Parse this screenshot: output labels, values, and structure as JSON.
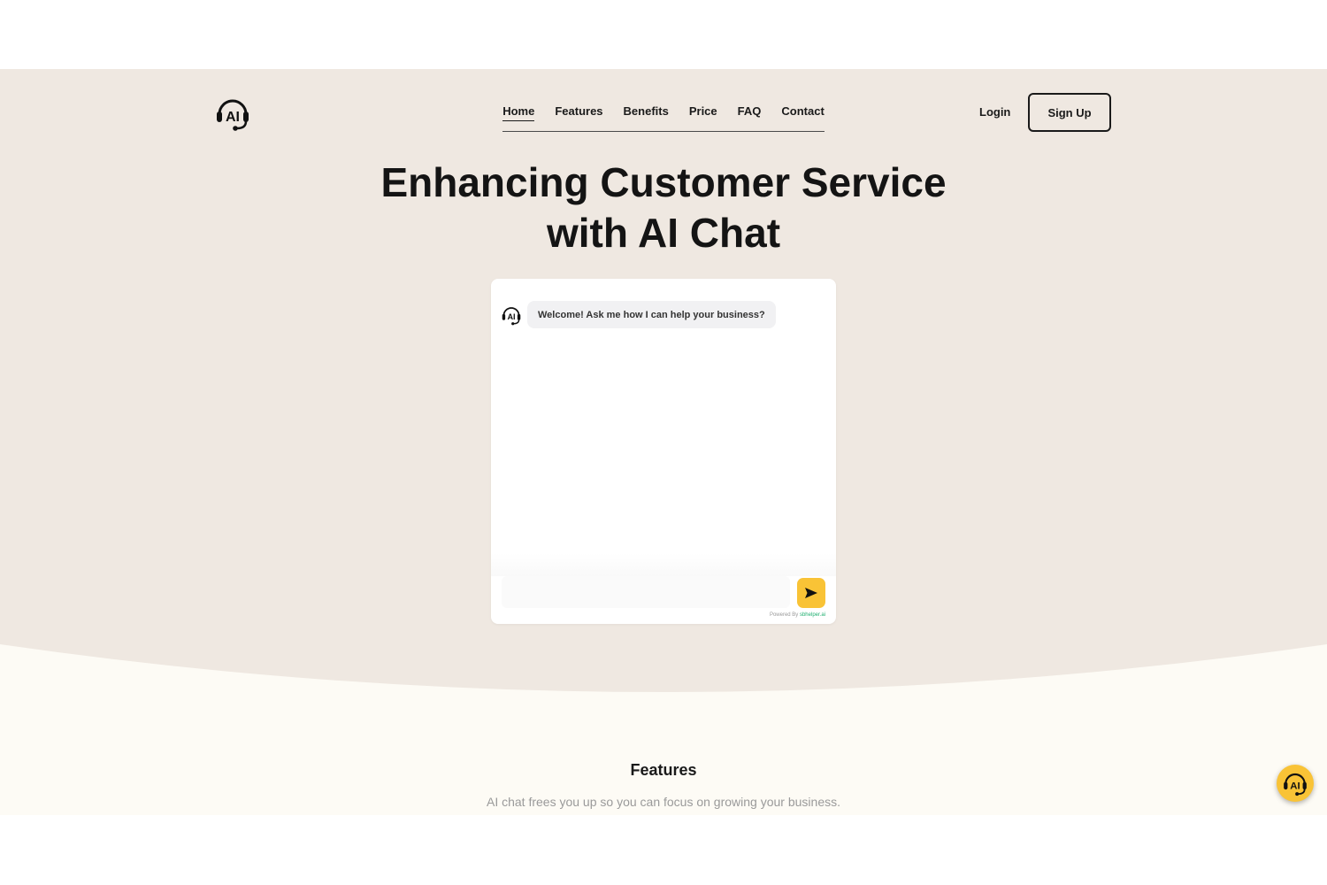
{
  "header": {
    "logo_text": "AI",
    "nav": [
      {
        "label": "Home",
        "active": true
      },
      {
        "label": "Features",
        "active": false
      },
      {
        "label": "Benefits",
        "active": false
      },
      {
        "label": "Price",
        "active": false
      },
      {
        "label": "FAQ",
        "active": false
      },
      {
        "label": "Contact",
        "active": false
      }
    ],
    "login_label": "Login",
    "signup_label": "Sign Up"
  },
  "hero": {
    "title_line1": "Enhancing Customer Service",
    "title_line2": "with AI Chat"
  },
  "chat": {
    "bot_icon": "headset-ai-icon",
    "welcome_message": "Welcome! Ask me how I can help your business?",
    "input_value": "",
    "input_placeholder": "",
    "send_icon": "send-arrow-icon",
    "powered_prefix": "Powered By",
    "powered_brand": "sbhelper.ai"
  },
  "features": {
    "title": "Features",
    "subtitle": "AI chat frees you up so you can focus on growing your business."
  },
  "floating_button": {
    "icon": "headset-ai-icon"
  },
  "colors": {
    "hero_bg": "#efe8e1",
    "section_bg": "#fdfbf5",
    "accent": "#f9c336",
    "brand_green": "#20b070"
  }
}
